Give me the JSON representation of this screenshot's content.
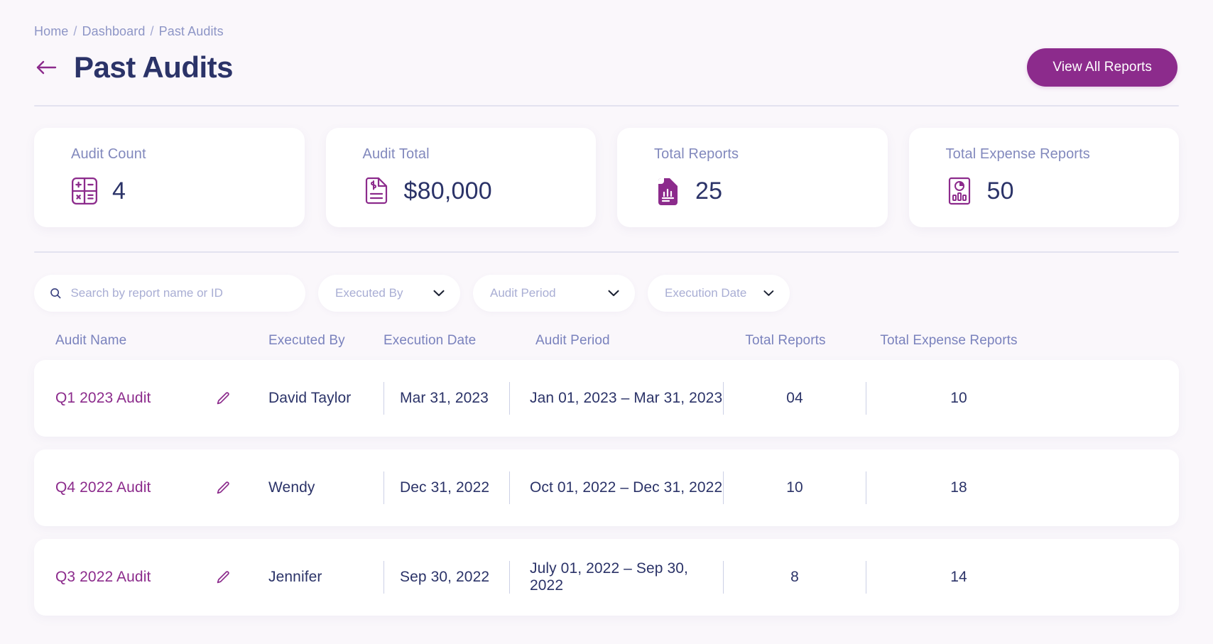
{
  "breadcrumb": {
    "items": [
      "Home",
      "Dashboard",
      "Past Audits"
    ],
    "separator": "/"
  },
  "header": {
    "title": "Past Audits",
    "back_icon": "arrow-left-icon",
    "primary_action": "View All Reports",
    "accent_color": "#8c2b8c",
    "title_color": "#2b3368"
  },
  "stats": [
    {
      "label": "Audit Count",
      "value": "4",
      "icon": "calculator-icon"
    },
    {
      "label": "Audit Total",
      "value": "$80,000",
      "icon": "invoice-dollar-icon"
    },
    {
      "label": "Total Reports",
      "value": "25",
      "icon": "report-bar-chart-icon"
    },
    {
      "label": "Total Expense Reports",
      "value": "50",
      "icon": "report-pie-chart-icon"
    }
  ],
  "filters": {
    "search": {
      "placeholder": "Search by report name or ID",
      "value": "",
      "icon": "search-icon"
    },
    "selects": [
      {
        "label": "Executed By",
        "icon": "chevron-down-icon"
      },
      {
        "label": "Audit Period",
        "icon": "chevron-down-icon"
      },
      {
        "label": "Execution Date",
        "icon": "chevron-down-icon"
      }
    ]
  },
  "table": {
    "columns": [
      "Audit Name",
      "Executed By",
      "Execution Date",
      "Audit Period",
      "Total Reports",
      "Total Expense Reports"
    ],
    "rows": [
      {
        "audit_name": "Q1 2023 Audit",
        "edit_icon": "pencil-icon",
        "executed_by": "David Taylor",
        "execution_date": "Mar 31, 2023",
        "audit_period": "Jan 01, 2023 – Mar 31, 2023",
        "total_reports": "04",
        "total_expense_reports": "10"
      },
      {
        "audit_name": "Q4 2022 Audit",
        "edit_icon": "pencil-icon",
        "executed_by": "Wendy",
        "execution_date": "Dec 31, 2022",
        "audit_period": "Oct 01, 2022 – Dec 31, 2022",
        "total_reports": "10",
        "total_expense_reports": "18"
      },
      {
        "audit_name": "Q3 2022 Audit",
        "edit_icon": "pencil-icon",
        "executed_by": "Jennifer",
        "execution_date": "Sep 30, 2022",
        "audit_period": "July 01, 2022 – Sep 30, 2022",
        "total_reports": "8",
        "total_expense_reports": "14"
      }
    ]
  }
}
